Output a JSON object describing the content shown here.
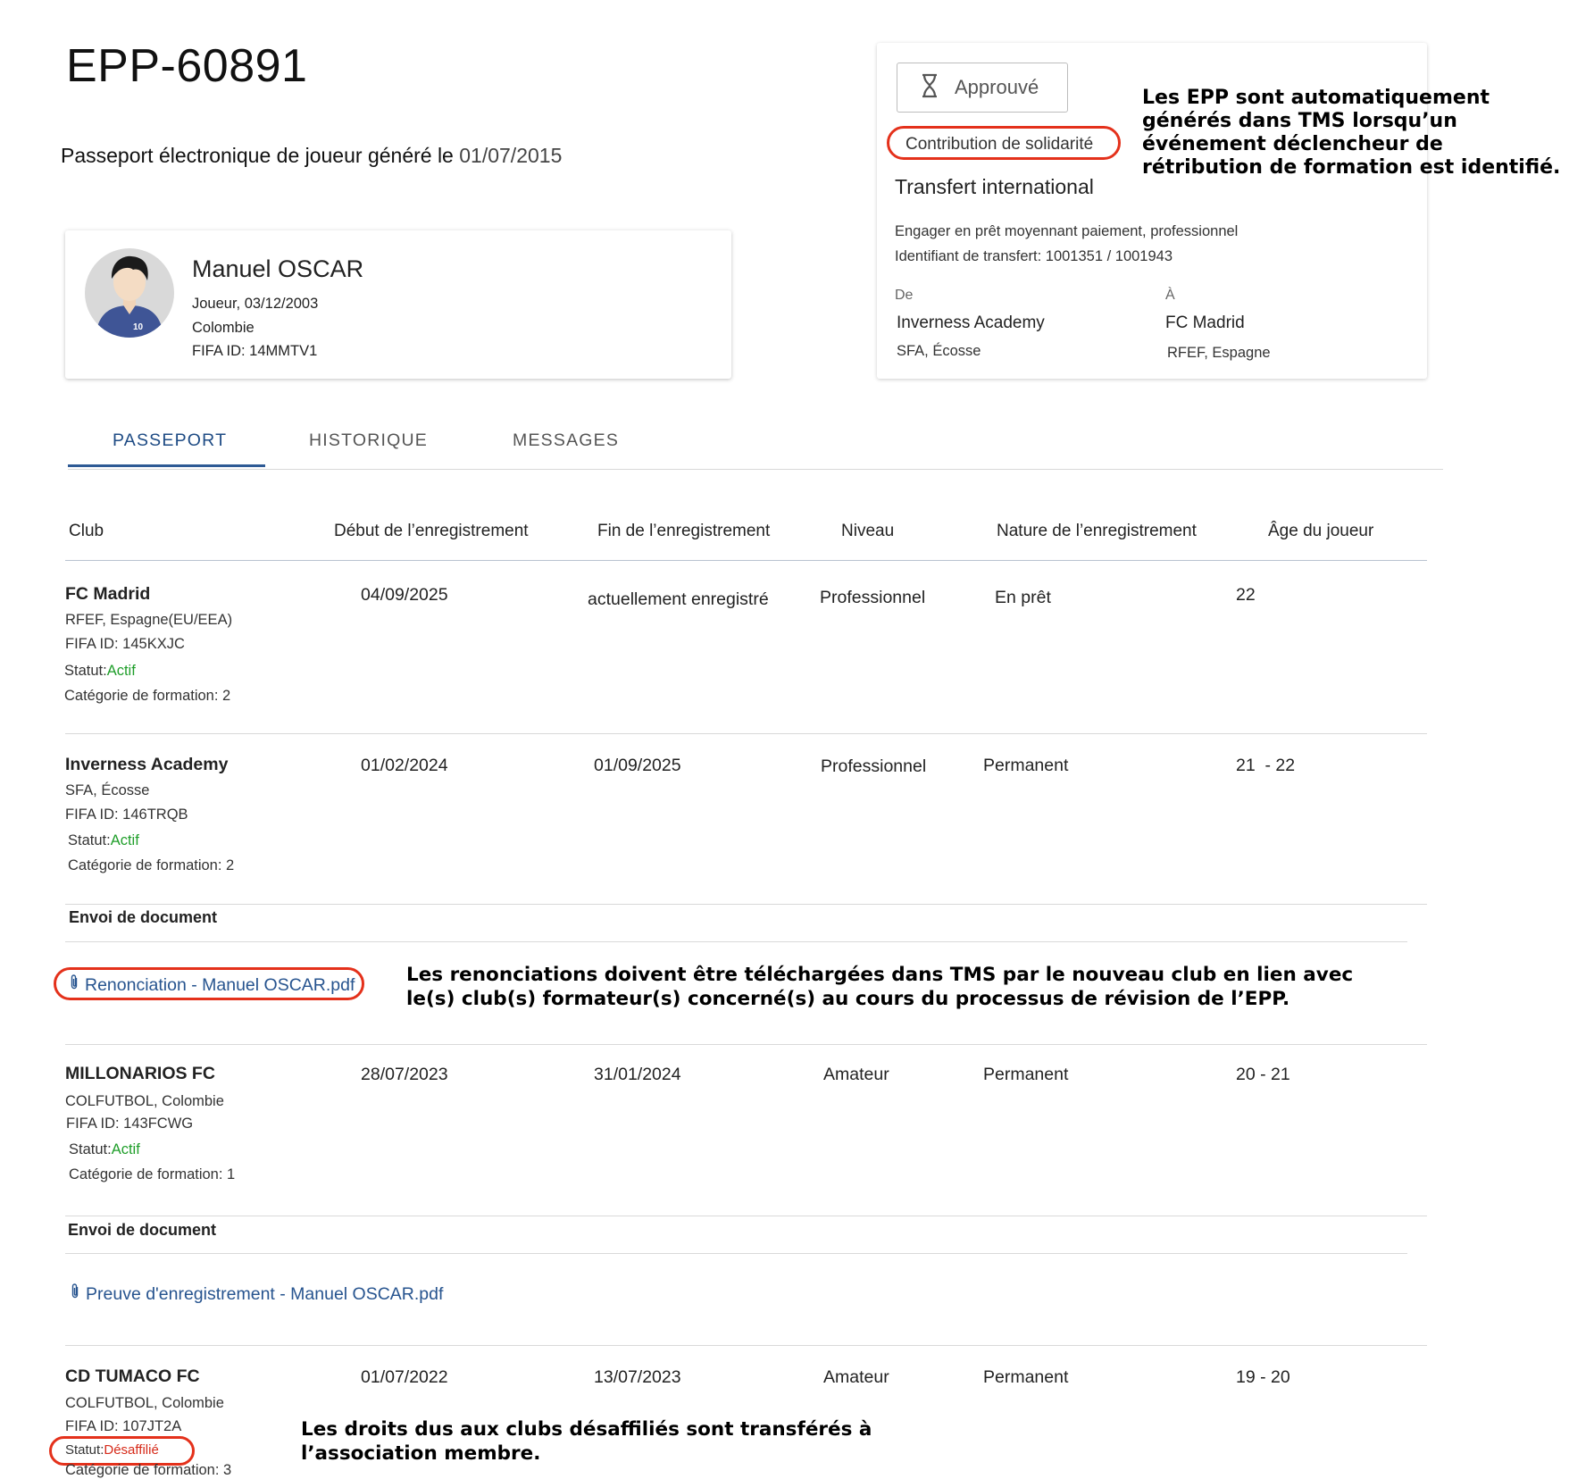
{
  "header": {
    "epp_id": "EPP-60891",
    "generated_text": "Passeport électronique de joueur généré le",
    "generated_date": "01/07/2015"
  },
  "player": {
    "name": "Manuel OSCAR",
    "role_birth": "Joueur, 03/12/2003",
    "country": "Colombie",
    "fifa_id": "FIFA ID: 14MMTV1",
    "jersey_number": "10"
  },
  "transfer": {
    "status_label": "Approuvé",
    "status_icon": "hourglass-icon",
    "solidarity_label": "Contribution de solidarité",
    "type": "Transfert international",
    "engagement": "Engager en prêt moyennant paiement, professionnel",
    "transfer_id_label": "Identifiant de transfert:",
    "transfer_id_value": "1001351 / 1001943",
    "from_label": "De",
    "from_club": "Inverness Academy",
    "from_assoc": "SFA, Écosse",
    "to_label": "À",
    "to_club": "FC Madrid",
    "to_assoc": "RFEF, Espagne"
  },
  "annotations": {
    "top": "Les EPP sont automatiquement générés dans TMS lorsqu’un événement déclencheur de rétribution de formation est identifié.",
    "middle": "Les renonciations doivent être téléchargées dans TMS par le nouveau club en lien avec le(s) club(s) formateur(s) concerné(s) au cours du processus de révision de l’EPP.",
    "bottom": "Les droits dus aux clubs désaffiliés sont transférés à l’association membre.",
    "highlight_color": "#e4311b"
  },
  "tabs": [
    {
      "label": "PASSEPORT",
      "active": true
    },
    {
      "label": "HISTORIQUE",
      "active": false
    },
    {
      "label": "MESSAGES",
      "active": false
    }
  ],
  "table": {
    "headers": [
      "Club",
      "Début de l’enregistrement",
      "Fin de l’enregistrement",
      "Niveau",
      "Nature de l’enregistrement",
      "Âge du joueur"
    ],
    "status_prefix": "Statut:",
    "rows": [
      {
        "club": "FC Madrid",
        "assoc": "RFEF, Espagne(EU/EEA)",
        "fifa_id": "FIFA ID: 145KXJC",
        "status": "Actif",
        "category": "Catégorie de formation: 2",
        "start": "04/09/2025",
        "end": "actuellement enregistré",
        "level": "Professionnel",
        "nature": "En prêt",
        "age": "22"
      },
      {
        "club": "Inverness Academy",
        "assoc": "SFA, Écosse",
        "fifa_id": "FIFA ID: 146TRQB",
        "status": "Actif",
        "category": "Catégorie de formation: 2",
        "start": "01/02/2024",
        "end": "01/09/2025",
        "level": "Professionnel",
        "nature": "Permanent",
        "age": "21  - 22",
        "doc_title": "Envoi de document",
        "doc_file": "Renonciation - Manuel OSCAR.pdf"
      },
      {
        "club": "MILLONARIOS FC",
        "assoc": "COLFUTBOL, Colombie",
        "fifa_id": "FIFA ID: 143FCWG",
        "status": "Actif",
        "category": "Catégorie de formation: 1",
        "start": "28/07/2023",
        "end": "31/01/2024",
        "level": "Amateur",
        "nature": "Permanent",
        "age": "20 - 21",
        "doc_title": "Envoi de document",
        "doc_file": "Preuve d'enregistrement - Manuel OSCAR.pdf"
      },
      {
        "club": "CD TUMACO FC",
        "assoc": "COLFUTBOL, Colombie",
        "fifa_id": "FIFA ID: 107JT2A",
        "status": "Désaffilié",
        "category": "Catégorie de formation: 3",
        "start": "01/07/2022",
        "end": "13/07/2023",
        "level": "Amateur",
        "nature": "Permanent",
        "age": "19 - 20"
      }
    ]
  },
  "colors": {
    "accent": "#1e4b84",
    "link": "#27548f",
    "active_status": "#1f9e2a",
    "disaffiliated_status": "#d62a19"
  }
}
